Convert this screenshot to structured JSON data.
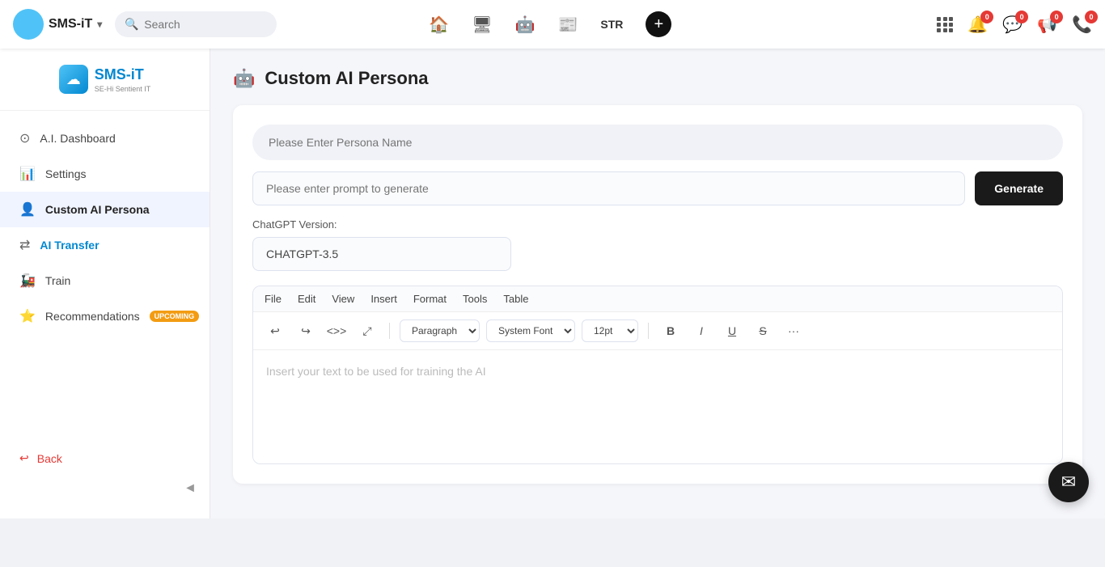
{
  "brand": {
    "name": "SMS-iT",
    "chevron": "▾"
  },
  "search": {
    "placeholder": "Search"
  },
  "nav_center": {
    "icons": [
      "🏠",
      "🖥",
      "🤖",
      "📰"
    ],
    "str_label": "STR",
    "plus_label": "+"
  },
  "nav_right": {
    "icons": [
      {
        "name": "grid-icon",
        "symbol": "⊞",
        "badge": null
      },
      {
        "name": "notification-icon",
        "symbol": "🔔",
        "badge": "0"
      },
      {
        "name": "message-icon",
        "symbol": "💬",
        "badge": "0"
      },
      {
        "name": "megaphone-icon",
        "symbol": "📢",
        "badge": "0"
      },
      {
        "name": "phone-icon",
        "symbol": "📞",
        "badge": "0"
      }
    ]
  },
  "sidebar": {
    "logo_text_prefix": "SMS-",
    "logo_text_suffix": "iT",
    "logo_subtitle": "SE-Hi Sentient IT",
    "items": [
      {
        "id": "ai-dashboard",
        "label": "A.I. Dashboard",
        "icon": "⊙",
        "active": false
      },
      {
        "id": "settings",
        "label": "Settings",
        "icon": "📊",
        "active": false
      },
      {
        "id": "custom-ai-persona",
        "label": "Custom AI Persona",
        "icon": "👤",
        "active": true
      },
      {
        "id": "ai-transfer",
        "label": "AI Transfer",
        "icon": "⇄",
        "active": false,
        "colored": true
      },
      {
        "id": "train",
        "label": "Train",
        "icon": "🚂",
        "active": false
      },
      {
        "id": "recommendations",
        "label": "Recommendations",
        "icon": "⭐",
        "active": false,
        "badge": "UPCOMING"
      }
    ],
    "back_label": "Back",
    "collapse_icon": "◄"
  },
  "page": {
    "title": "Custom AI Persona",
    "header_icon": "🤖"
  },
  "form": {
    "persona_name_placeholder": "Please Enter Persona Name",
    "prompt_placeholder": "Please enter prompt to generate",
    "generate_btn": "Generate",
    "chatgpt_version_label": "ChatGPT Version:",
    "chatgpt_version_value": "CHATGPT-3.5"
  },
  "editor": {
    "menu_items": [
      "File",
      "Edit",
      "View",
      "Insert",
      "Format",
      "Tools",
      "Table"
    ],
    "paragraph_select": "Paragraph",
    "font_select": "System Font",
    "size_select": "12pt",
    "placeholder": "Insert your text to be used for training the AI"
  }
}
